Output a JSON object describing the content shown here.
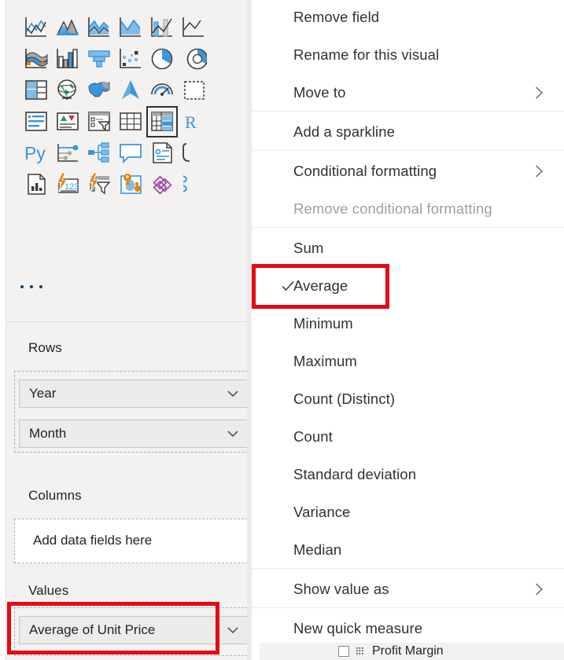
{
  "visualizations": {
    "gallery_name": "visualizations-gallery",
    "more_label": "…",
    "icons": [
      {
        "name": "line-and-stacked-column-chart-icon",
        "label": "Line and clustered column chart"
      },
      {
        "name": "area-chart-icon",
        "label": "Area chart"
      },
      {
        "name": "stacked-area-chart-icon",
        "label": "Stacked area chart"
      },
      {
        "name": "line-chart-filled-icon",
        "label": "Line chart"
      },
      {
        "name": "line-and-clustered-column-chart-icon",
        "label": "Line and clustered column chart"
      },
      {
        "name": "ribbon-chart-partial-icon",
        "label": "Ribbon chart"
      },
      {
        "name": "waterfall-chart-icon",
        "label": "Waterfall chart"
      },
      {
        "name": "clustered-column-chart-icon",
        "label": "Clustered column chart"
      },
      {
        "name": "funnel-chart-icon",
        "label": "Funnel"
      },
      {
        "name": "scatter-chart-icon",
        "label": "Scatter chart"
      },
      {
        "name": "pie-chart-icon",
        "label": "Pie chart"
      },
      {
        "name": "donut-chart-partial-icon",
        "label": "Donut chart"
      },
      {
        "name": "treemap-icon",
        "label": "Treemap"
      },
      {
        "name": "globe-map-icon",
        "label": "Map"
      },
      {
        "name": "filled-map-icon",
        "label": "Filled map"
      },
      {
        "name": "azure-map-icon",
        "label": "Azure map"
      },
      {
        "name": "gauge-icon",
        "label": "Gauge"
      },
      {
        "name": "card-partial-icon",
        "label": "Card"
      },
      {
        "name": "multi-row-card-icon",
        "label": "Multi-row card"
      },
      {
        "name": "kpi-icon",
        "label": "KPI"
      },
      {
        "name": "slicer-icon",
        "label": "Slicer"
      },
      {
        "name": "table-icon",
        "label": "Table"
      },
      {
        "name": "matrix-icon",
        "label": "Matrix"
      },
      {
        "name": "r-visual-partial-icon",
        "label": "R script visual"
      },
      {
        "name": "python-visual-icon",
        "label": "Python visual"
      },
      {
        "name": "key-influencers-icon",
        "label": "Key influencers"
      },
      {
        "name": "decomposition-tree-icon",
        "label": "Decomposition tree"
      },
      {
        "name": "q-and-a-icon",
        "label": "Q&A"
      },
      {
        "name": "smart-narrative-icon",
        "label": "Smart narrative"
      },
      {
        "name": "metrics-partial-icon",
        "label": "Metrics"
      },
      {
        "name": "paginated-report-icon",
        "label": "Paginated report"
      },
      {
        "name": "power-apps-icon",
        "label": "Power Apps for Power BI"
      },
      {
        "name": "power-automate-icon",
        "label": "Power Automate for Power BI"
      },
      {
        "name": "arcgis-map-icon",
        "label": "ArcGIS Maps for Power BI"
      },
      {
        "name": "purple-diamonds-icon",
        "label": "Visio visual"
      },
      {
        "name": "partial-blue-icon",
        "label": "More visuals"
      }
    ]
  },
  "field_wells": [
    {
      "section": "Rows",
      "name": "rows-well",
      "fields": [
        {
          "label": "Year"
        },
        {
          "label": "Month"
        }
      ],
      "placeholder": null
    },
    {
      "section": "Columns",
      "name": "columns-well",
      "fields": [],
      "placeholder": "Add data fields here"
    },
    {
      "section": "Values",
      "name": "values-well",
      "fields": [
        {
          "label": "Average of Unit Price"
        }
      ],
      "placeholder": null
    }
  ],
  "background_field": {
    "label": "Profit Margin",
    "checked": false
  },
  "context_menu": {
    "name": "field-context-menu",
    "items": [
      {
        "label": "Remove field",
        "name": "menu-item-remove-field",
        "submenu": false,
        "checked": false,
        "disabled": false,
        "separator_after": false
      },
      {
        "label": "Rename for this visual",
        "name": "menu-item-rename-for-this-visual",
        "submenu": false,
        "checked": false,
        "disabled": false,
        "separator_after": false
      },
      {
        "label": "Move to",
        "name": "menu-item-move-to",
        "submenu": true,
        "checked": false,
        "disabled": false,
        "separator_after": true
      },
      {
        "label": "Add a sparkline",
        "name": "menu-item-add-a-sparkline",
        "submenu": false,
        "checked": false,
        "disabled": false,
        "separator_after": true
      },
      {
        "label": "Conditional formatting",
        "name": "menu-item-conditional-formatting",
        "submenu": true,
        "checked": false,
        "disabled": false,
        "separator_after": false
      },
      {
        "label": "Remove conditional formatting",
        "name": "menu-item-remove-conditional-formatting",
        "submenu": false,
        "checked": false,
        "disabled": true,
        "separator_after": true
      },
      {
        "label": "Sum",
        "name": "menu-item-sum",
        "submenu": false,
        "checked": false,
        "disabled": false,
        "separator_after": false
      },
      {
        "label": "Average",
        "name": "menu-item-average",
        "submenu": false,
        "checked": true,
        "disabled": false,
        "separator_after": false
      },
      {
        "label": "Minimum",
        "name": "menu-item-minimum",
        "submenu": false,
        "checked": false,
        "disabled": false,
        "separator_after": false
      },
      {
        "label": "Maximum",
        "name": "menu-item-maximum",
        "submenu": false,
        "checked": false,
        "disabled": false,
        "separator_after": false
      },
      {
        "label": "Count (Distinct)",
        "name": "menu-item-count-distinct",
        "submenu": false,
        "checked": false,
        "disabled": false,
        "separator_after": false
      },
      {
        "label": "Count",
        "name": "menu-item-count",
        "submenu": false,
        "checked": false,
        "disabled": false,
        "separator_after": false
      },
      {
        "label": "Standard deviation",
        "name": "menu-item-standard-deviation",
        "submenu": false,
        "checked": false,
        "disabled": false,
        "separator_after": false
      },
      {
        "label": "Variance",
        "name": "menu-item-variance",
        "submenu": false,
        "checked": false,
        "disabled": false,
        "separator_after": false
      },
      {
        "label": "Median",
        "name": "menu-item-median",
        "submenu": false,
        "checked": false,
        "disabled": false,
        "separator_after": true
      },
      {
        "label": "Show value as",
        "name": "menu-item-show-value-as",
        "submenu": true,
        "checked": false,
        "disabled": false,
        "separator_after": true
      },
      {
        "label": "New quick measure",
        "name": "menu-item-new-quick-measure",
        "submenu": false,
        "checked": false,
        "disabled": false,
        "separator_after": false
      }
    ]
  },
  "annotations": [
    {
      "name": "annotation-average-highlight",
      "target": "Average",
      "color": "#e50914"
    },
    {
      "name": "annotation-values-field-highlight",
      "target": "Average of Unit Price",
      "color": "#e50914"
    }
  ]
}
